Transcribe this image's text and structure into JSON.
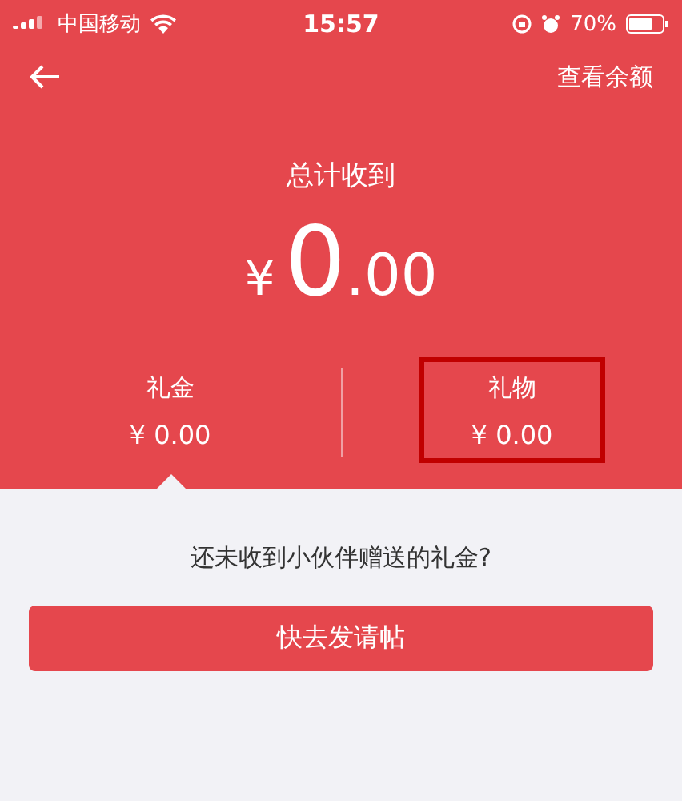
{
  "status_bar": {
    "carrier": "中国移动",
    "time": "15:57",
    "battery": "70%"
  },
  "nav": {
    "action": "查看余额"
  },
  "total": {
    "label": "总计收到",
    "currency": "¥",
    "integer": "0",
    "decimal": ".00"
  },
  "tabs": [
    {
      "label": "礼金",
      "value": "¥ 0.00",
      "selected": true,
      "highlighted": false
    },
    {
      "label": "礼物",
      "value": "¥ 0.00",
      "selected": false,
      "highlighted": true
    }
  ],
  "empty": {
    "message": "还未收到小伙伴赠送的礼金?",
    "button": "快去发请帖"
  }
}
